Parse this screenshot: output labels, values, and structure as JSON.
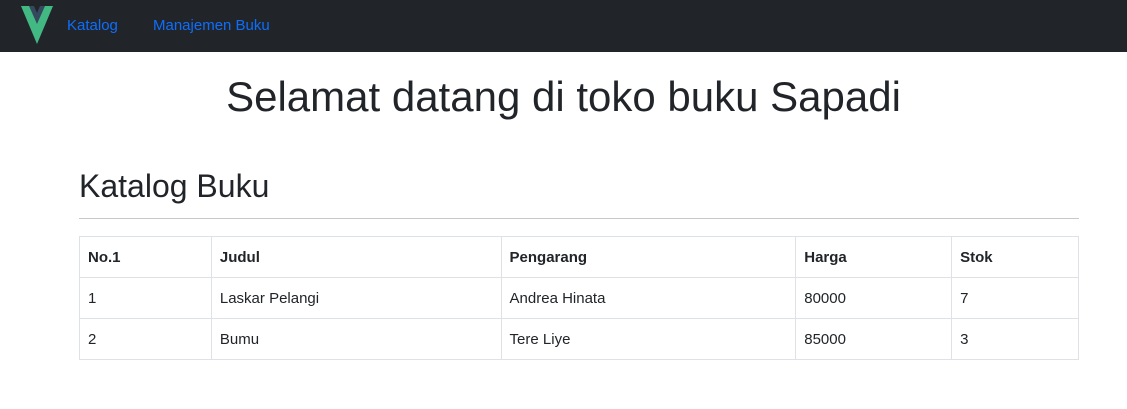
{
  "nav": {
    "brand_icon": "vue-logo-icon",
    "links": [
      {
        "label": "Katalog"
      },
      {
        "label": "Manajemen Buku"
      }
    ],
    "colors": {
      "background": "#212529",
      "link": "#0d6efd",
      "logo_green": "#42b883",
      "logo_dark": "#35495e"
    }
  },
  "main": {
    "welcome": "Selamat datang di toko buku Sapadi",
    "section_title": "Katalog Buku",
    "table": {
      "headers": [
        "No.1",
        "Judul",
        "Pengarang",
        "Harga",
        "Stok"
      ],
      "rows": [
        [
          "1",
          "Laskar Pelangi",
          "Andrea Hinata",
          "80000",
          "7"
        ],
        [
          "2",
          "Bumu",
          "Tere Liye",
          "85000",
          "3"
        ]
      ]
    }
  }
}
